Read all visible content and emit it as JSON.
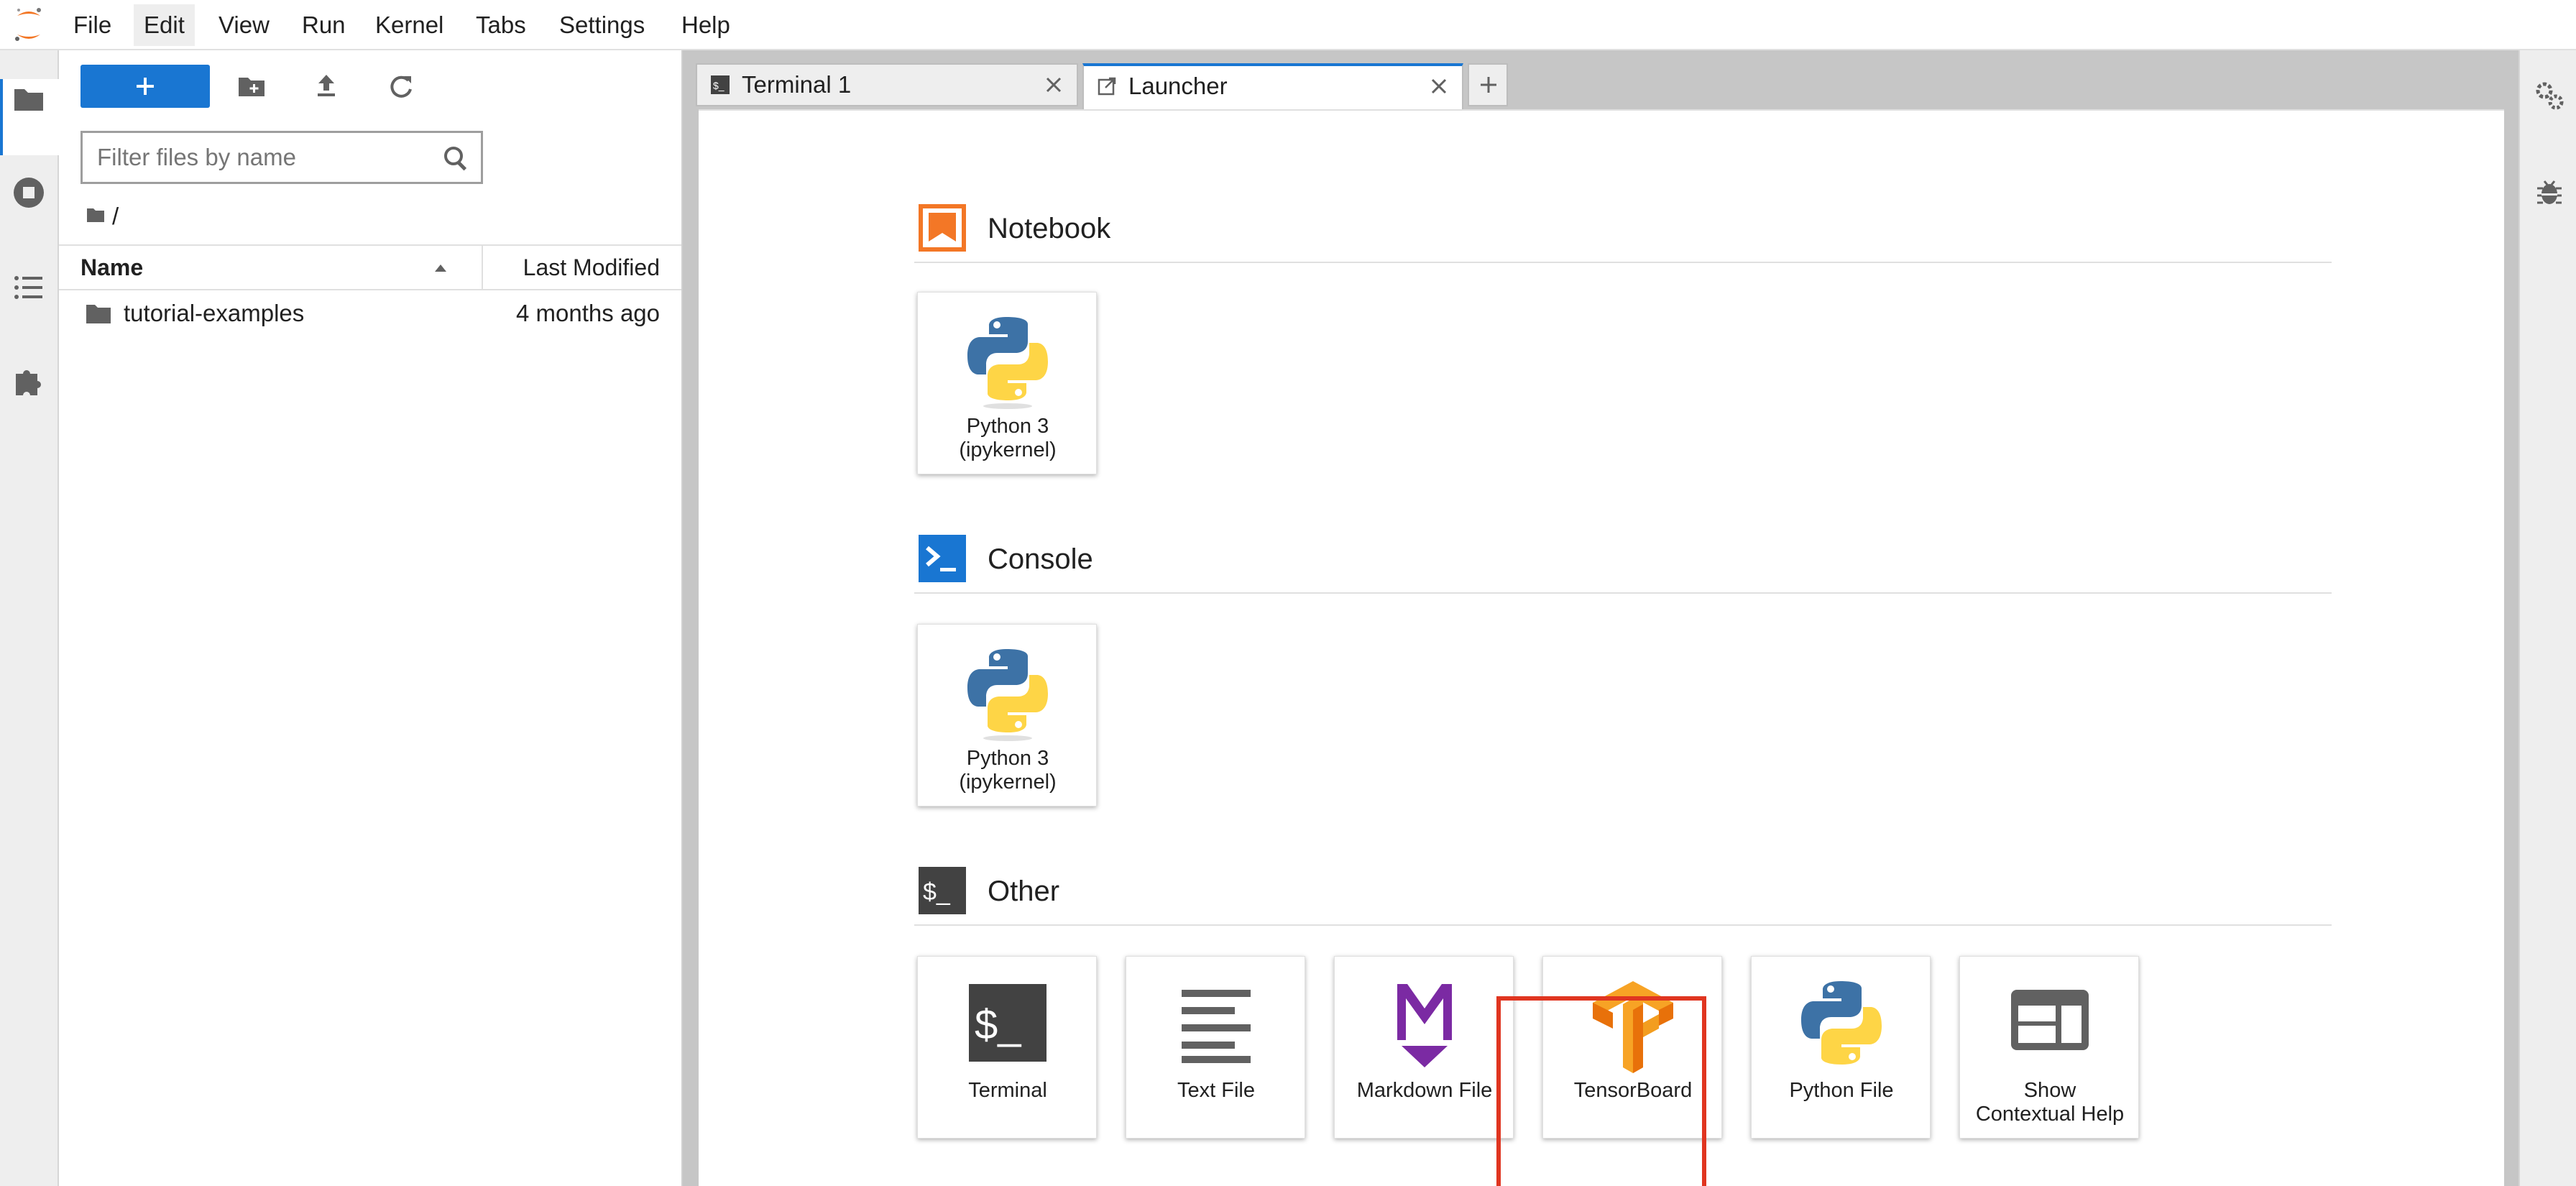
{
  "menu": {
    "items": [
      "File",
      "Edit",
      "View",
      "Run",
      "Kernel",
      "Tabs",
      "Settings",
      "Help"
    ],
    "active": "Edit"
  },
  "left_sidebar": {
    "icons": [
      "folder-icon",
      "running-sessions-icon",
      "table-of-contents-icon",
      "extensions-icon"
    ]
  },
  "file_browser": {
    "new_button": "+",
    "filter_placeholder": "Filter files by name",
    "breadcrumb": "/",
    "columns": {
      "name": "Name",
      "modified": "Last Modified"
    },
    "files": [
      {
        "name": "tutorial-examples",
        "modified": "4 months ago",
        "type": "folder"
      }
    ]
  },
  "tabs": [
    {
      "label": "Terminal 1",
      "icon": "terminal-tab-icon",
      "current": false
    },
    {
      "label": "Launcher",
      "icon": "launcher-tab-icon",
      "current": true
    }
  ],
  "launcher": {
    "sections": [
      {
        "title": "Notebook",
        "cards": [
          {
            "label": "Python 3\n(ipykernel)",
            "icon": "python-logo-icon"
          }
        ]
      },
      {
        "title": "Console",
        "cards": [
          {
            "label": "Python 3\n(ipykernel)",
            "icon": "python-logo-icon"
          }
        ]
      },
      {
        "title": "Other",
        "cards": [
          {
            "label": "Terminal",
            "icon": "terminal-icon"
          },
          {
            "label": "Text File",
            "icon": "text-file-icon"
          },
          {
            "label": "Markdown File",
            "icon": "markdown-icon"
          },
          {
            "label": "TensorBoard",
            "icon": "tensorflow-logo-icon",
            "highlighted": true
          },
          {
            "label": "Python File",
            "icon": "python-logo-icon"
          },
          {
            "label": "Show\nContextual Help",
            "icon": "contextual-help-icon"
          }
        ]
      }
    ]
  },
  "right_sidebar": {
    "icons": [
      "property-inspector-icon",
      "debugger-icon"
    ]
  },
  "colors": {
    "accent": "#1976d2",
    "highlight": "#e03520",
    "notebook": "#f37726",
    "console": "#1976d2",
    "other": "#424242"
  }
}
